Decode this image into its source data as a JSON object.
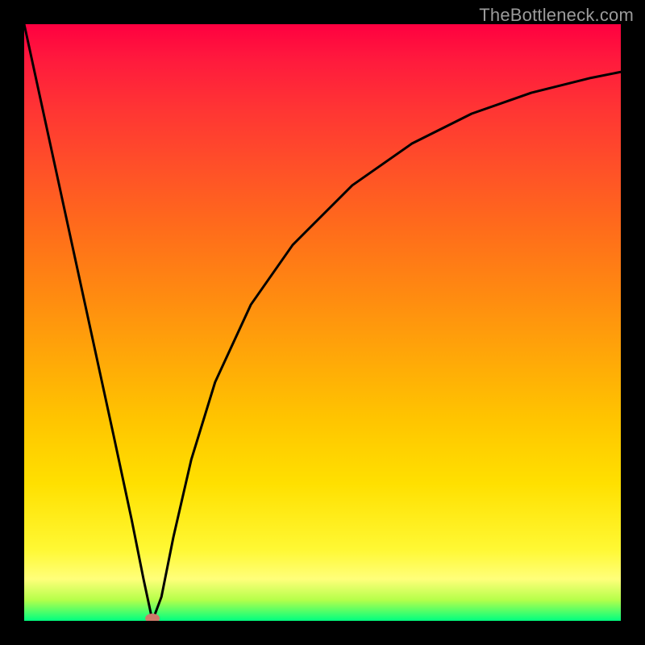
{
  "watermark": "TheBottleneck.com",
  "chart_data": {
    "type": "line",
    "title": "",
    "xlabel": "",
    "ylabel": "",
    "xlim": [
      0,
      100
    ],
    "ylim": [
      0,
      100
    ],
    "grid": false,
    "legend": false,
    "series": [
      {
        "name": "bottleneck-curve",
        "x": [
          0,
          5,
          10,
          15,
          18,
          20,
          21.5,
          23,
          25,
          28,
          32,
          38,
          45,
          55,
          65,
          75,
          85,
          95,
          100
        ],
        "y": [
          100,
          77,
          54,
          31,
          17,
          7,
          0,
          4,
          14,
          27,
          40,
          53,
          63,
          73,
          80,
          85,
          88.5,
          91,
          92
        ]
      }
    ],
    "marker": {
      "name": "optimum-point",
      "x": 21.5,
      "y": 0,
      "color": "#cf7a6a"
    },
    "colors": {
      "curve": "#000000",
      "background_top": "#ff0040",
      "background_bottom": "#00ff80",
      "frame": "#000000"
    }
  }
}
